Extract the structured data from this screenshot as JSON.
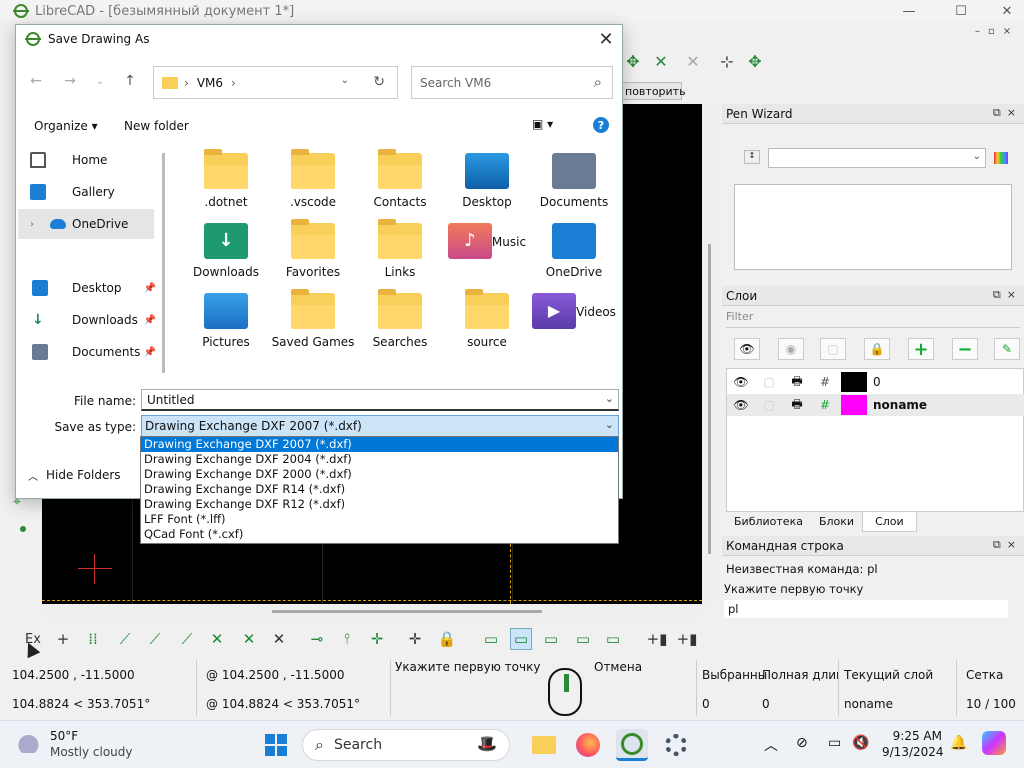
{
  "app": {
    "title": "LibreCAD - [безымянный документ 1*]",
    "window_controls": [
      "—",
      "☐",
      "✕"
    ],
    "repeat_button": "повторить"
  },
  "pen_wizard": {
    "title": "Pen Wizard"
  },
  "layers": {
    "title": "Слои",
    "filter_placeholder": "Filter",
    "rows": [
      {
        "name": "0",
        "color": "#000000",
        "bold": false
      },
      {
        "name": "noname",
        "color": "#ff00ff",
        "bold": true
      }
    ],
    "tabs": [
      "Библиотека",
      "Блоки",
      "Слои"
    ],
    "active_tab": "Слои"
  },
  "command_line": {
    "title": "Командная строка",
    "lines": [
      "Неизвестная команда: pl",
      "Укажите первую точку"
    ],
    "input": "pl"
  },
  "status": {
    "abs_coord": "104.2500 , -11.5000",
    "abs_polar": "104.8824 < 353.7051°",
    "rel_coord": "@  104.2500 , -11.5000",
    "rel_polar": "@  104.8824 < 353.7051°",
    "prompt": "Укажите первую точку",
    "cancel": "Отмена",
    "selected_label": "Выбранны",
    "selected_value": "0",
    "total_label": "Полная длина",
    "total_value": "0",
    "current_layer_label": "Текущий слой",
    "current_layer_value": "noname",
    "grid_label": "Сетка",
    "grid_value": "10 / 100"
  },
  "dialog": {
    "title": "Save Drawing As",
    "path": [
      "VM6"
    ],
    "search_placeholder": "Search VM6",
    "organize": "Organize",
    "new_folder": "New folder",
    "nav_items": [
      "Home",
      "Gallery",
      "OneDrive",
      "Desktop",
      "Downloads",
      "Documents"
    ],
    "files": [
      {
        "name": ".dotnet",
        "kind": "folder"
      },
      {
        "name": ".vscode",
        "kind": "folder"
      },
      {
        "name": "Contacts",
        "kind": "folder"
      },
      {
        "name": "Desktop",
        "kind": "desktop"
      },
      {
        "name": "Documents",
        "kind": "documents"
      },
      {
        "name": "Downloads",
        "kind": "downloads"
      },
      {
        "name": "Favorites",
        "kind": "folder"
      },
      {
        "name": "Links",
        "kind": "folder"
      },
      {
        "name": "Music",
        "kind": "music"
      },
      {
        "name": "OneDrive",
        "kind": "onedrive"
      },
      {
        "name": "Pictures",
        "kind": "pictures"
      },
      {
        "name": "Saved Games",
        "kind": "folder"
      },
      {
        "name": "Searches",
        "kind": "folder"
      },
      {
        "name": "source",
        "kind": "folder"
      },
      {
        "name": "Videos",
        "kind": "videos"
      }
    ],
    "file_name_label": "File name:",
    "file_name_value": "Untitled",
    "save_type_label": "Save as type:",
    "save_type_value": "Drawing Exchange DXF 2007 (*.dxf)",
    "type_options": [
      "Drawing Exchange DXF 2007 (*.dxf)",
      "Drawing Exchange DXF 2004 (*.dxf)",
      "Drawing Exchange DXF 2000 (*.dxf)",
      "Drawing Exchange DXF R14 (*.dxf)",
      "Drawing Exchange DXF R12 (*.dxf)",
      "LFF Font (*.lff)",
      "QCad Font (*.cxf)"
    ],
    "hide_folders": "Hide Folders"
  },
  "taskbar": {
    "weather_temp": "50°F",
    "weather_desc": "Mostly cloudy",
    "search": "Search",
    "time": "9:25 AM",
    "date": "9/13/2024"
  }
}
